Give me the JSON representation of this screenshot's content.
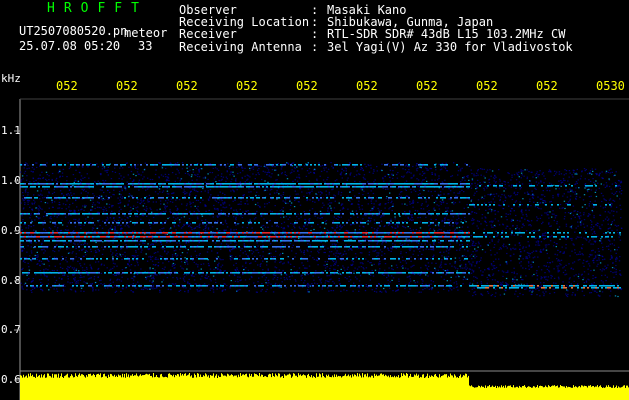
{
  "header": {
    "title": "HROFFT",
    "file_name": "UT2507080520.pn",
    "type_label": "meteor",
    "date_time": "25.07.08 05:20",
    "count": "33",
    "info": [
      {
        "key": "Observer",
        "value": "Masaki Kano"
      },
      {
        "key": "Receiving Location",
        "value": "Shibukawa, Gunma, Japan"
      },
      {
        "key": "Receiver",
        "value": "RTL-SDR SDR# 43dB L15 103.2MHz CW"
      },
      {
        "key": "Receiving Antenna",
        "value": "3el Yagi(V) Az 330 for Vladivostok"
      }
    ]
  },
  "axis": {
    "unit": "kHz",
    "y_labels": [
      "1.1",
      "1.0",
      "0.9",
      "0.8",
      "0.7",
      "0.6"
    ],
    "time_labels": [
      "052",
      "052",
      "052",
      "052",
      "052",
      "052",
      "052",
      "052",
      "052",
      "0530"
    ]
  },
  "colors": {
    "background": "#000000",
    "title": "#00ff00",
    "time_labels": "#ffff00",
    "text": "#ffffff",
    "noise": "#0000a0",
    "signal": "#00c8ff",
    "strong_signal": "#ff3030",
    "amplitude": "#ffff00"
  }
}
